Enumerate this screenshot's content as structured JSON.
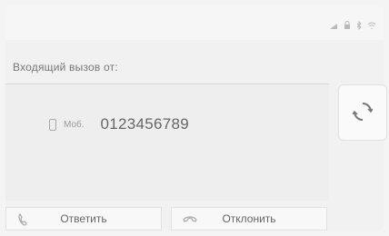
{
  "status": {
    "icons": [
      "signal-icon",
      "lock-icon",
      "bluetooth-icon",
      "wifi-icon"
    ]
  },
  "call": {
    "title": "Входящий вызов от:",
    "type_label": "Моб.",
    "number": "0123456789"
  },
  "actions": {
    "accept_label": "Ответить",
    "decline_label": "Отклонить"
  },
  "colors": {
    "background": "#f1f1f1",
    "text": "#666666",
    "border": "#d8d8d8"
  }
}
